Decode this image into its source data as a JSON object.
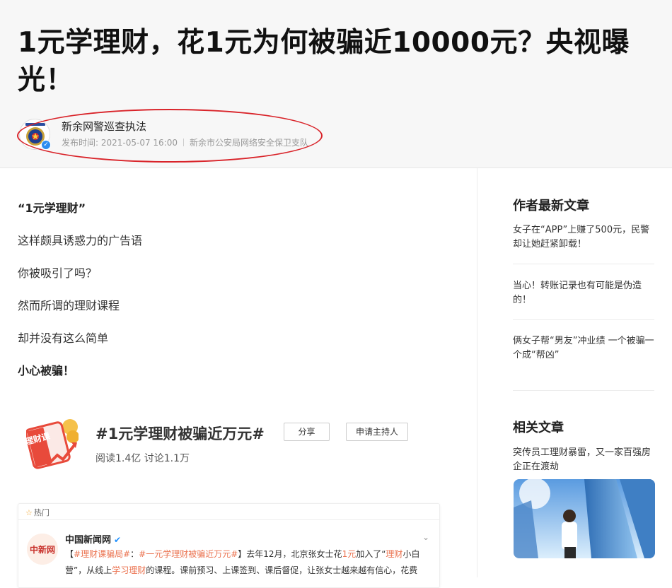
{
  "article": {
    "title": "1元学理财，花1元为何被骗近10000元？央视曝光！",
    "author": "新余网警巡查执法",
    "publish_time": "发布时间: 2021-05-07 16:00",
    "author_org": "新余市公安局网络安全保卫支队",
    "paragraphs": [
      "“1元学理财”",
      "这样颇具诱惑力的广告语",
      "你被吸引了吗？",
      "然而所谓的理财课程",
      "却并没有这么简单",
      "小心被骗！"
    ]
  },
  "weibo_topic": {
    "thumb_text": "理财课",
    "title": "#1元学理财被骗近万元#",
    "share_label": "分享",
    "host_label": "申请主持人",
    "stats": "阅读1.4亿    讨论1.1万"
  },
  "hot_post": {
    "hot_label": "热门",
    "source_name": "中国新闻网",
    "logo_text": "中新网",
    "text_prefix": "【",
    "tag1": "#理财课骗局#",
    "colon": "：",
    "tag2": "#一元学理财被骗近万元#",
    "text_mid": "】去年12月，北京张女士花",
    "hl_yuan": "1元",
    "text_mid2": "加入了“",
    "hl_licai": "理财",
    "text_mid3": "小白营”，从线上",
    "hl_study": "学习理财",
    "text_end": "的课程。课前预习、上课签到、课后督促，让张女士越来越有信心，花费"
  },
  "sidebar": {
    "latest_title": "作者最新文章",
    "latest_items": [
      "女子在“APP”上赚了500元，民警却让她赶紧卸载！",
      "当心！转账记录也有可能是伪造的！",
      "俩女子帮“男友”冲业绩 一个被骗一个成“帮凶”"
    ],
    "related_title": "相关文章",
    "related_items": [
      "突传员工理财暴雷，又一家百强房企正在渡劫"
    ]
  },
  "colors": {
    "highlight_ellipse": "#d9242a",
    "weibo_link": "#eb7350",
    "verified_blue": "#2d8cf0"
  }
}
